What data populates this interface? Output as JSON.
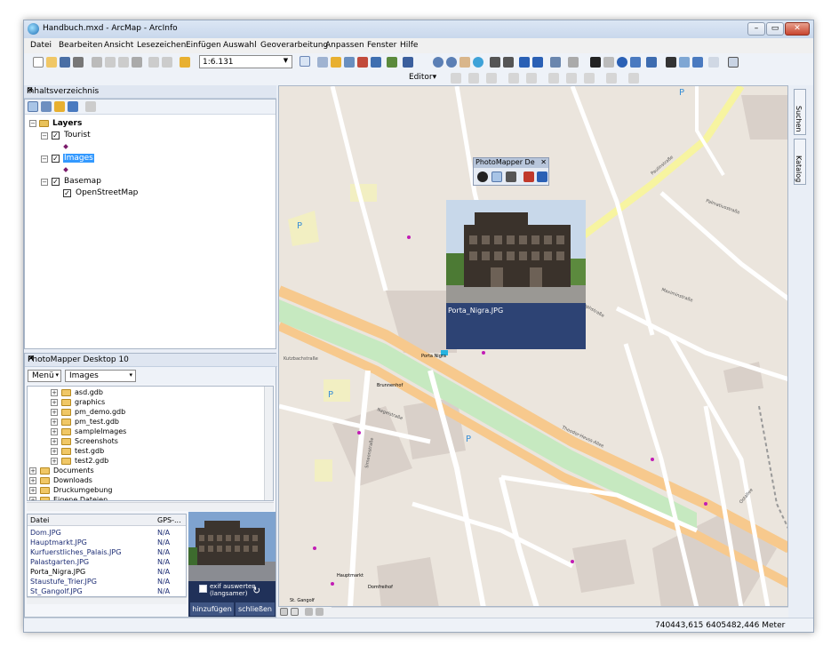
{
  "window": {
    "title": "Handbuch.mxd - ArcMap - ArcInfo",
    "min": "–",
    "max": "▭",
    "close": "✕"
  },
  "menu": [
    "Datei",
    "Bearbeiten",
    "Ansicht",
    "Lesezeichen",
    "Einfügen",
    "Auswahl",
    "Geoverarbeitung",
    "Anpassen",
    "Fenster",
    "Hilfe"
  ],
  "toolbar": {
    "scale": "1:6.131",
    "editor": "Editor▾"
  },
  "toc": {
    "title": "Inhaltsverzeichnis",
    "root": "Layers",
    "layers": [
      "Tourist",
      "Images",
      "Basemap",
      "OpenStreetMap"
    ]
  },
  "photomapper_tool": {
    "title": "PhotoMapper De"
  },
  "photomapper": {
    "title": "PhotoMapper Desktop 10",
    "menu_label": "Menü",
    "select_value": "Images",
    "folders": [
      "asd.gdb",
      "graphics",
      "pm_demo.gdb",
      "pm_test.gdb",
      "sampleImages",
      "Screenshots",
      "test.gdb",
      "test2.gdb",
      "Documents",
      "Downloads",
      "Druckumgebung",
      "Eigene Dateien"
    ],
    "file_header": {
      "name": "Datei",
      "gps": "GPS-..."
    },
    "files": [
      {
        "name": "Dom.JPG",
        "gps": "N/A"
      },
      {
        "name": "Hauptmarkt.JPG",
        "gps": "N/A"
      },
      {
        "name": "Kurfuerstliches_Palais.JPG",
        "gps": "N/A"
      },
      {
        "name": "Palastgarten.JPG",
        "gps": "N/A"
      },
      {
        "name": "Porta_Nigra.JPG",
        "gps": "N/A"
      },
      {
        "name": "Staustufe_Trier.JPG",
        "gps": "N/A"
      },
      {
        "name": "St_Gangolf.JPG",
        "gps": "N/A"
      }
    ],
    "exif_label": "exif auswerten (langsamer)",
    "add_button": "hinzufügen",
    "close_button": "schließen"
  },
  "popup": {
    "caption": "Porta_Nigra.JPG"
  },
  "sidebar_tabs": [
    "Suchen",
    "Katalog"
  ],
  "status": {
    "coords": "740443,615  6405482,446 Meter"
  },
  "map_labels": {
    "paulinstrasse": "Paulinstraße",
    "christophstrasse": "Christophstraße",
    "theodor_heuss": "Theodor-Heuss-Allee",
    "porta_nigra": "Porta Nigra",
    "brunnenhof": "Brunnenhof",
    "simeonstrasse": "Simeonstraße",
    "nagelstrasse": "Nagelstraße",
    "hauptmarkt": "Hauptmarkt",
    "dom": "Domfreihof",
    "st_gangolf": "St. Gangolf",
    "kutzbach": "Kutzbachstraße",
    "ostallee": "Ostallee",
    "palmatius": "Palmatiusstraße",
    "maximin": "Maximinstraße"
  },
  "colors": {
    "popup": "#2d4374",
    "highlight": "#3399ff",
    "map_bg": "#ebe5dd"
  }
}
